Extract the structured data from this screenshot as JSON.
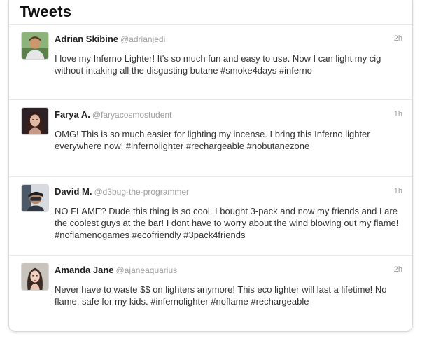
{
  "header": {
    "title": "Tweets"
  },
  "tweets": [
    {
      "name": "Adrian Skibine",
      "handle": "@adrianjedi",
      "time": "2h",
      "text": "I love my Inferno Lighter! It's so much fun and easy to use. Now I can light my cig without intaking all the disgusting butane #smoke4days #inferno",
      "avatar_icon": "avatar-photo"
    },
    {
      "name": "Farya A.",
      "handle": "@faryacosmostudent",
      "time": "1h",
      "text": "OMG! This is so much easier for lighting my incense. I bring this Inferno lighter everywhere now! #infernolighter #rechargeable #nobutanezone",
      "avatar_icon": "avatar-photo"
    },
    {
      "name": "David M.",
      "handle": "@d3bug-the-programmer",
      "time": "1h",
      "text": "NO FLAME? Dude this thing is so cool. I bought 3-pack and now my friends and I are the coolest guys at the bar! I dont have to worry about the wind blowing out my flame! #noflamenogames #ecofriendly #3pack4friends",
      "avatar_icon": "avatar-photo"
    },
    {
      "name": "Amanda Jane",
      "handle": "@ajaneaquarius",
      "time": "2h",
      "text": "Never have to waste $$ on lighters anymore! This eco lighter will last a lifetime! No flame, safe for my kids. #infernolighter #noflame #rechargeable",
      "avatar_icon": "avatar-photo"
    }
  ]
}
